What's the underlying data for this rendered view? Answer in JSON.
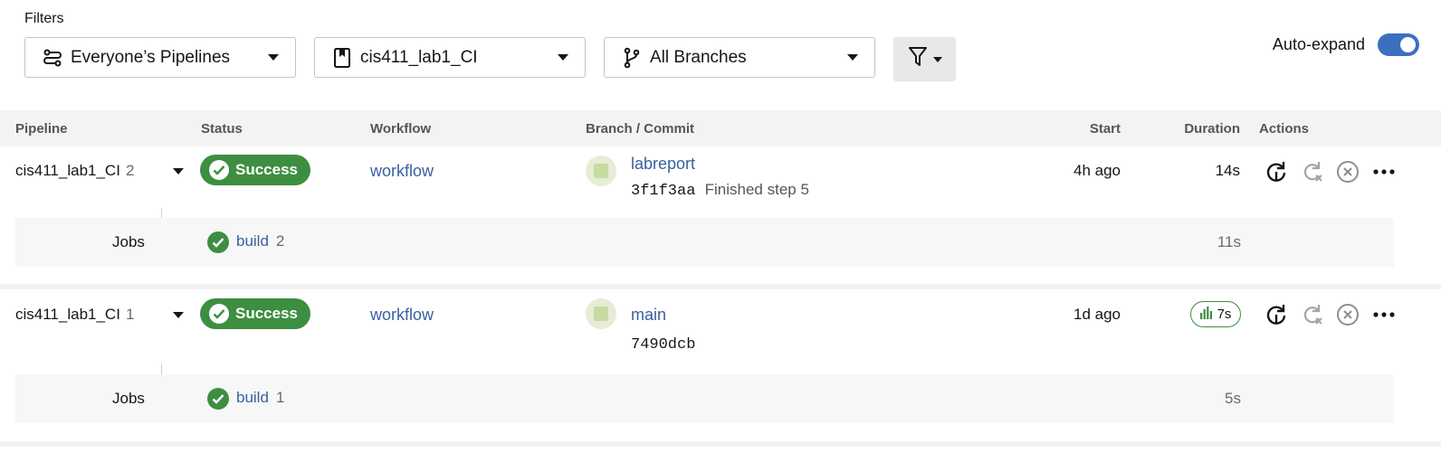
{
  "filters": {
    "title": "Filters",
    "pipelines_dropdown": {
      "label": "Everyone’s Pipelines",
      "icon": "pipelines-icon"
    },
    "project_dropdown": {
      "label": "cis411_lab1_CI",
      "icon": "bookmark-icon"
    },
    "branch_dropdown": {
      "label": "All Branches",
      "icon": "branch-icon"
    },
    "filter_button_icon": "filter-funnel-icon"
  },
  "auto_expand": {
    "label": "Auto-expand",
    "enabled": true
  },
  "table": {
    "headers": {
      "pipeline": "Pipeline",
      "status": "Status",
      "workflow": "Workflow",
      "branch_commit": "Branch / Commit",
      "start": "Start",
      "duration": "Duration",
      "actions": "Actions"
    },
    "rows": [
      {
        "project": "cis411_lab1_CI",
        "number": "2",
        "status": "Success",
        "workflow": "workflow",
        "branch": "labreport",
        "commit_hash": "3f1f3aa",
        "commit_message": "Finished step 5",
        "start": "4h ago",
        "duration": "14s",
        "jobs_label": "Jobs",
        "job": {
          "name": "build",
          "number": "2",
          "duration": "11s"
        }
      },
      {
        "project": "cis411_lab1_CI",
        "number": "1",
        "status": "Success",
        "workflow": "workflow",
        "branch": "main",
        "commit_hash": "7490dcb",
        "commit_message": "",
        "start": "1d ago",
        "duration": "7s",
        "jobs_label": "Jobs",
        "job": {
          "name": "build",
          "number": "1",
          "duration": "5s"
        }
      }
    ]
  },
  "colors": {
    "success": "#3e8e41",
    "link": "#3a5f9f",
    "toggle": "#3d6fc1"
  }
}
